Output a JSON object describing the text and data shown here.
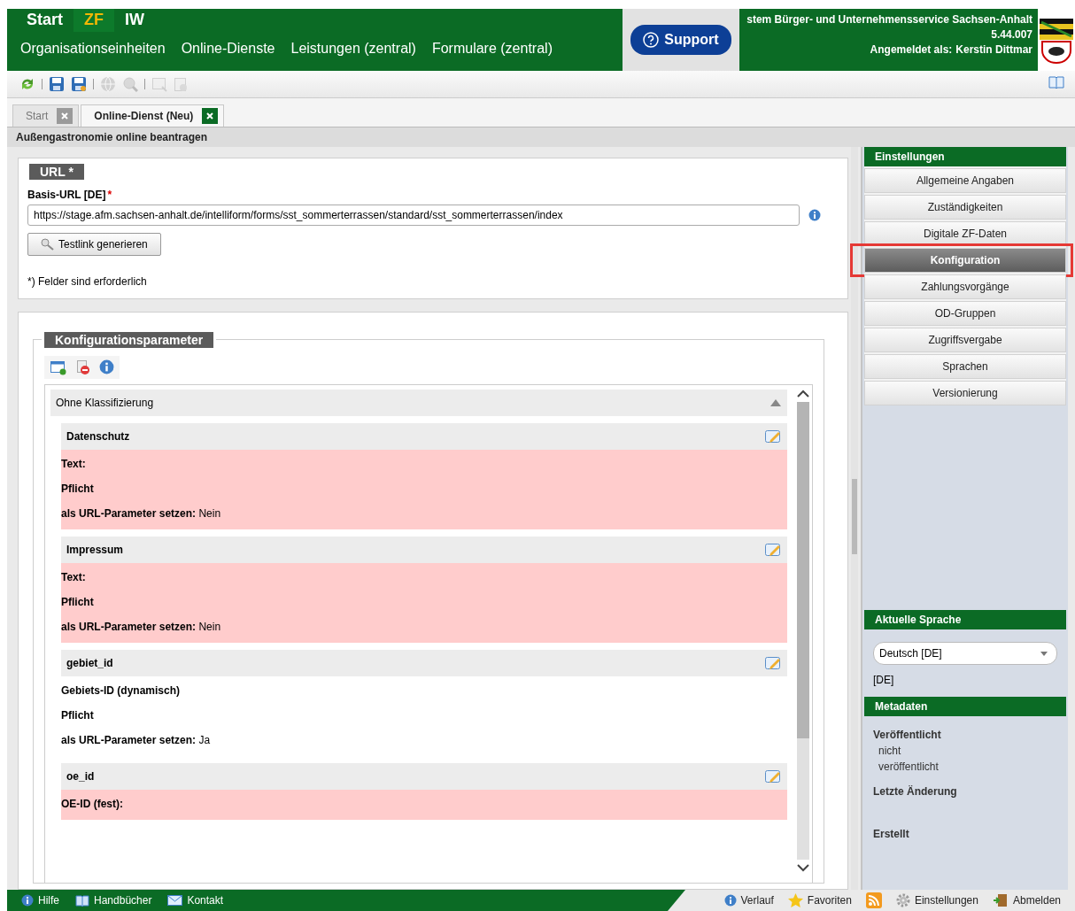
{
  "header": {
    "nav_tabs": [
      {
        "label": "Start",
        "selected": false
      },
      {
        "label": "ZF",
        "selected": true
      },
      {
        "label": "IW",
        "selected": false
      }
    ],
    "menu": [
      "Organisationseinheiten",
      "Online-Dienste",
      "Leistungen (zentral)",
      "Formulare (zentral)"
    ],
    "support_button": "Support",
    "system_title": "stem Bürger- und Unternehmensservice Sachsen-Anhalt",
    "version": "5.44.007",
    "login_label": "Angemeldet als:",
    "user": "Kerstin Dittmar"
  },
  "toolbar": [
    {
      "kind": "refresh",
      "disabled": false
    },
    {
      "kind": "save",
      "disabled": false
    },
    {
      "kind": "save-as",
      "disabled": false
    },
    {
      "kind": "globe",
      "disabled": true
    },
    {
      "kind": "search",
      "disabled": true
    },
    {
      "kind": "preview",
      "disabled": true
    },
    {
      "kind": "delete",
      "disabled": true
    }
  ],
  "doc_tabs": [
    {
      "label": "Start",
      "selected": false
    },
    {
      "label": "Online-Dienst (Neu)",
      "selected": true
    }
  ],
  "page_title": "Außengastronomie online beantragen",
  "url_section": {
    "legend": "URL *",
    "field_label": "Basis-URL [DE]",
    "required_mark": "*",
    "value": "https://stage.afm.sachsen-anhalt.de/intelliform/forms/sst_sommerterrassen/standard/sst_sommerterrassen/index",
    "button": "Testlink generieren",
    "note": "*) Felder sind erforderlich"
  },
  "config_section": {
    "legend": "Konfigurationsparameter",
    "group": {
      "title": "Ohne Klassifizierung",
      "expanded": true
    },
    "params": [
      {
        "title": "Datenschutz",
        "highlighted": true,
        "lines": [
          {
            "label": "Text:"
          },
          {
            "label": "Pflicht"
          },
          {
            "label": "als URL-Parameter setzen:",
            "value": "Nein"
          }
        ]
      },
      {
        "title": "Impressum",
        "highlighted": true,
        "lines": [
          {
            "label": "Text:"
          },
          {
            "label": "Pflicht"
          },
          {
            "label": "als URL-Parameter setzen:",
            "value": "Nein"
          }
        ]
      },
      {
        "title": "gebiet_id",
        "highlighted": false,
        "lines": [
          {
            "label": "Gebiets-ID (dynamisch)"
          },
          {
            "label": "Pflicht"
          },
          {
            "label": "als URL-Parameter setzen:",
            "value": "Ja"
          }
        ]
      },
      {
        "title": "oe_id",
        "highlighted": true,
        "lines": [
          {
            "label": "OE-ID (fest):"
          }
        ]
      }
    ]
  },
  "sidebar": {
    "settings_header": "Einstellungen",
    "items": [
      {
        "label": "Allgemeine Angaben",
        "selected": false,
        "annotated": false
      },
      {
        "label": "Zuständigkeiten",
        "selected": false,
        "annotated": false
      },
      {
        "label": "Digitale ZF-Daten",
        "selected": false,
        "annotated": false
      },
      {
        "label": "Konfiguration",
        "selected": true,
        "annotated": true
      },
      {
        "label": "Zahlungsvorgänge",
        "selected": false,
        "annotated": false
      },
      {
        "label": "OD-Gruppen",
        "selected": false,
        "annotated": false
      },
      {
        "label": "Zugriffsvergabe",
        "selected": false,
        "annotated": false
      },
      {
        "label": "Sprachen",
        "selected": false,
        "annotated": false
      },
      {
        "label": "Versionierung",
        "selected": false,
        "annotated": false
      }
    ],
    "language_header": "Aktuelle Sprache",
    "language_select": "Deutsch [DE]",
    "language_code": "[DE]",
    "metadata_header": "Metadaten",
    "metadata": [
      {
        "label": "Veröffentlicht",
        "value": "nicht veröffentlicht"
      },
      {
        "label": "Letzte Änderung"
      },
      {
        "label": "Erstellt"
      }
    ]
  },
  "footer": {
    "left": [
      {
        "kind": "info",
        "label": "Hilfe"
      },
      {
        "kind": "book",
        "label": "Handbücher"
      },
      {
        "kind": "mail",
        "label": "Kontakt"
      }
    ],
    "right": [
      {
        "kind": "info",
        "label": "Verlauf"
      },
      {
        "kind": "star",
        "label": "Favoriten"
      },
      {
        "kind": "rss"
      },
      {
        "kind": "gear",
        "label": "Einstellungen"
      },
      {
        "kind": "door",
        "label": "Abmelden"
      }
    ]
  }
}
